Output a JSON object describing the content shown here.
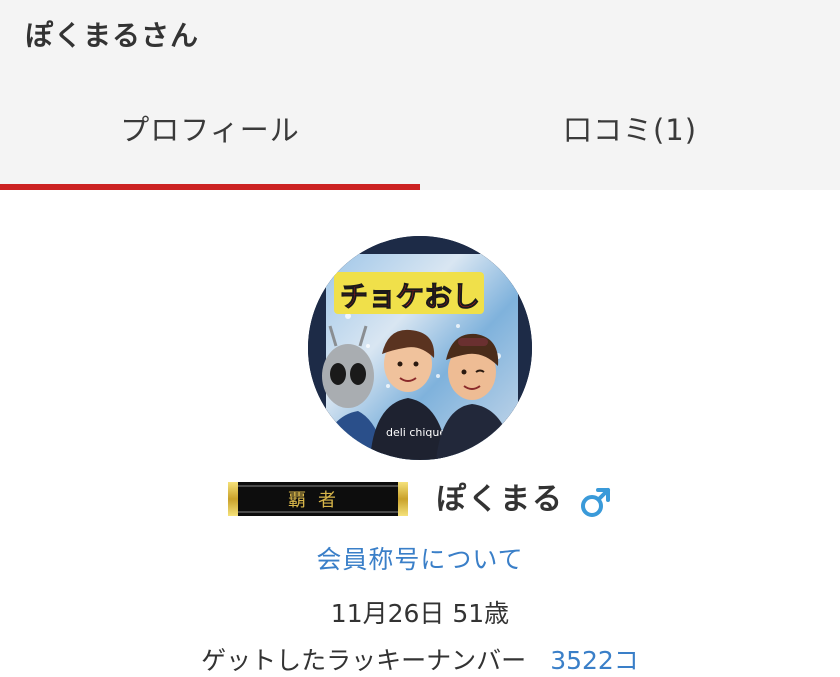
{
  "header": {
    "title": "ぽくまるさん"
  },
  "tabs": [
    {
      "label": "プロフィール",
      "active": true
    },
    {
      "label": "口コミ(1)",
      "active": false
    }
  ],
  "colors": {
    "tab_indicator": "#cc2222",
    "link": "#3a7fc8",
    "gender_icon": "#3a9ad9",
    "header_bg": "#f4f4f4"
  },
  "profile": {
    "avatar_caption": "チョケおし",
    "avatar_shirt_text": "deli chique",
    "rank_badge_text": "覇者",
    "user_name": "ぽくまる",
    "gender_icon": "male-icon",
    "member_title_link": "会員称号について",
    "birthday_age": "11月26日 51歳",
    "lucky_number_label": "ゲットしたラッキーナンバー",
    "lucky_number_count": "3522コ"
  }
}
